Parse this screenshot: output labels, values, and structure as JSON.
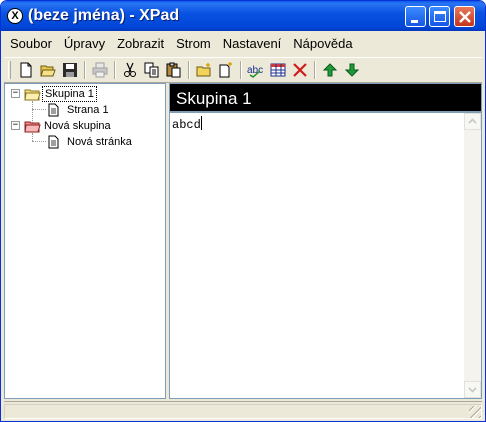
{
  "window": {
    "title": "(beze jména) - XPad",
    "icon_letter": "X",
    "controls": [
      "minimize-icon",
      "maximize-icon",
      "close-icon"
    ],
    "accent": "#0a53e2",
    "close_color": "#c2361c"
  },
  "menu": [
    {
      "label": "Soubor",
      "name": "menu-soubor"
    },
    {
      "label": "Úpravy",
      "name": "menu-upravy"
    },
    {
      "label": "Zobrazit",
      "name": "menu-zobrazit"
    },
    {
      "label": "Strom",
      "name": "menu-strom"
    },
    {
      "label": "Nastavení",
      "name": "menu-nastaveni"
    },
    {
      "label": "Nápověda",
      "name": "menu-napoveda"
    }
  ],
  "toolbar": {
    "icons": [
      "new-file-icon",
      "open-folder-icon",
      "save-icon",
      "print-icon",
      "cut-icon",
      "copy-icon",
      "paste-icon",
      "new-group-icon",
      "new-page-icon",
      "spell-check-icon",
      "table-icon",
      "delete-icon",
      "move-up-icon",
      "move-down-icon"
    ]
  },
  "tree": {
    "nodes": [
      {
        "label": "Skupina 1",
        "type": "group",
        "expanded": true,
        "selected": true,
        "folder_color": "#f5e27a"
      },
      {
        "label": "Strana 1",
        "type": "page",
        "parent": 0
      },
      {
        "label": "Nová skupina",
        "type": "group",
        "expanded": true,
        "selected": false,
        "folder_color": "#f08a8a"
      },
      {
        "label": "Nová stránka",
        "type": "page",
        "parent": 2
      }
    ]
  },
  "page": {
    "title": "Skupina 1",
    "content": "abcd"
  },
  "statusbar": {
    "text": ""
  }
}
